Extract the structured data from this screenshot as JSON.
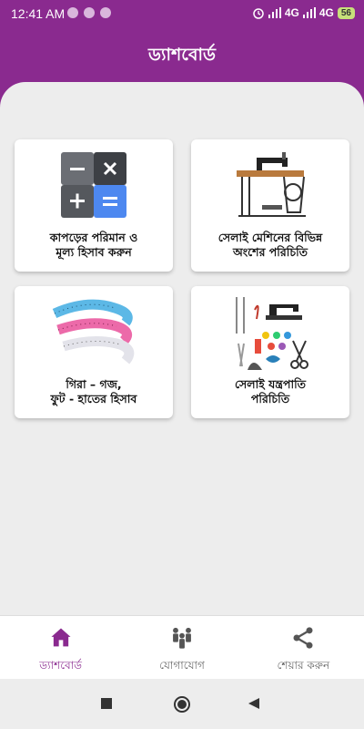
{
  "status_bar": {
    "time": "12:41 AM",
    "network_1": "4G",
    "network_2": "4G",
    "battery": "56"
  },
  "app_bar": {
    "title": "ড্যাশবোর্ড"
  },
  "cards": [
    {
      "label_line1": "কাপড়ের পরিমান ও",
      "label_line2": "মূল্য হিসাব করুন",
      "icon": "calculator-icon"
    },
    {
      "label_line1": "সেলাই মেশিনের বিভিন্ন",
      "label_line2": "অংশের পরিচিতি",
      "icon": "sewing-machine-icon"
    },
    {
      "label_line1": "গিরা – গজ,",
      "label_line2": "ফুট - হাতের হিসাব",
      "icon": "measuring-tape-icon"
    },
    {
      "label_line1": "সেলাই যন্ত্রপাতি",
      "label_line2": "পরিচিতি",
      "icon": "sewing-tools-icon"
    }
  ],
  "bottom_nav": [
    {
      "label": "ড্যাশবোর্ড",
      "icon": "home-icon",
      "active": true
    },
    {
      "label": "যোগাযোগ",
      "icon": "contacts-icon",
      "active": false
    },
    {
      "label": "শেয়ার করুন",
      "icon": "share-icon",
      "active": false
    }
  ],
  "colors": {
    "primary": "#8a2a8f",
    "background": "#ededed",
    "card": "#ffffff"
  }
}
